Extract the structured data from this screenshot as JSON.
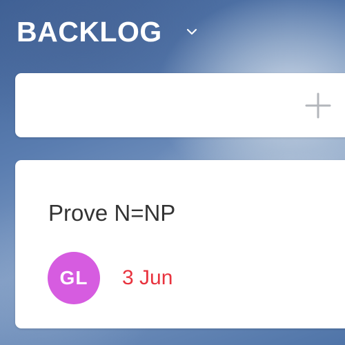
{
  "column": {
    "title": "BACKLOG",
    "menu_icon": "chevron-down-icon"
  },
  "add_card": {
    "icon": "plus-icon"
  },
  "card": {
    "title": "Prove N=NP",
    "assignee_initials": "GL",
    "due_date": "3 Jun"
  },
  "colors": {
    "avatar": "#d65ce0",
    "due_date": "#e8333e",
    "plus_icon": "#b3b6bb",
    "card_background": "#ffffff",
    "title_text": "#ffffff"
  }
}
